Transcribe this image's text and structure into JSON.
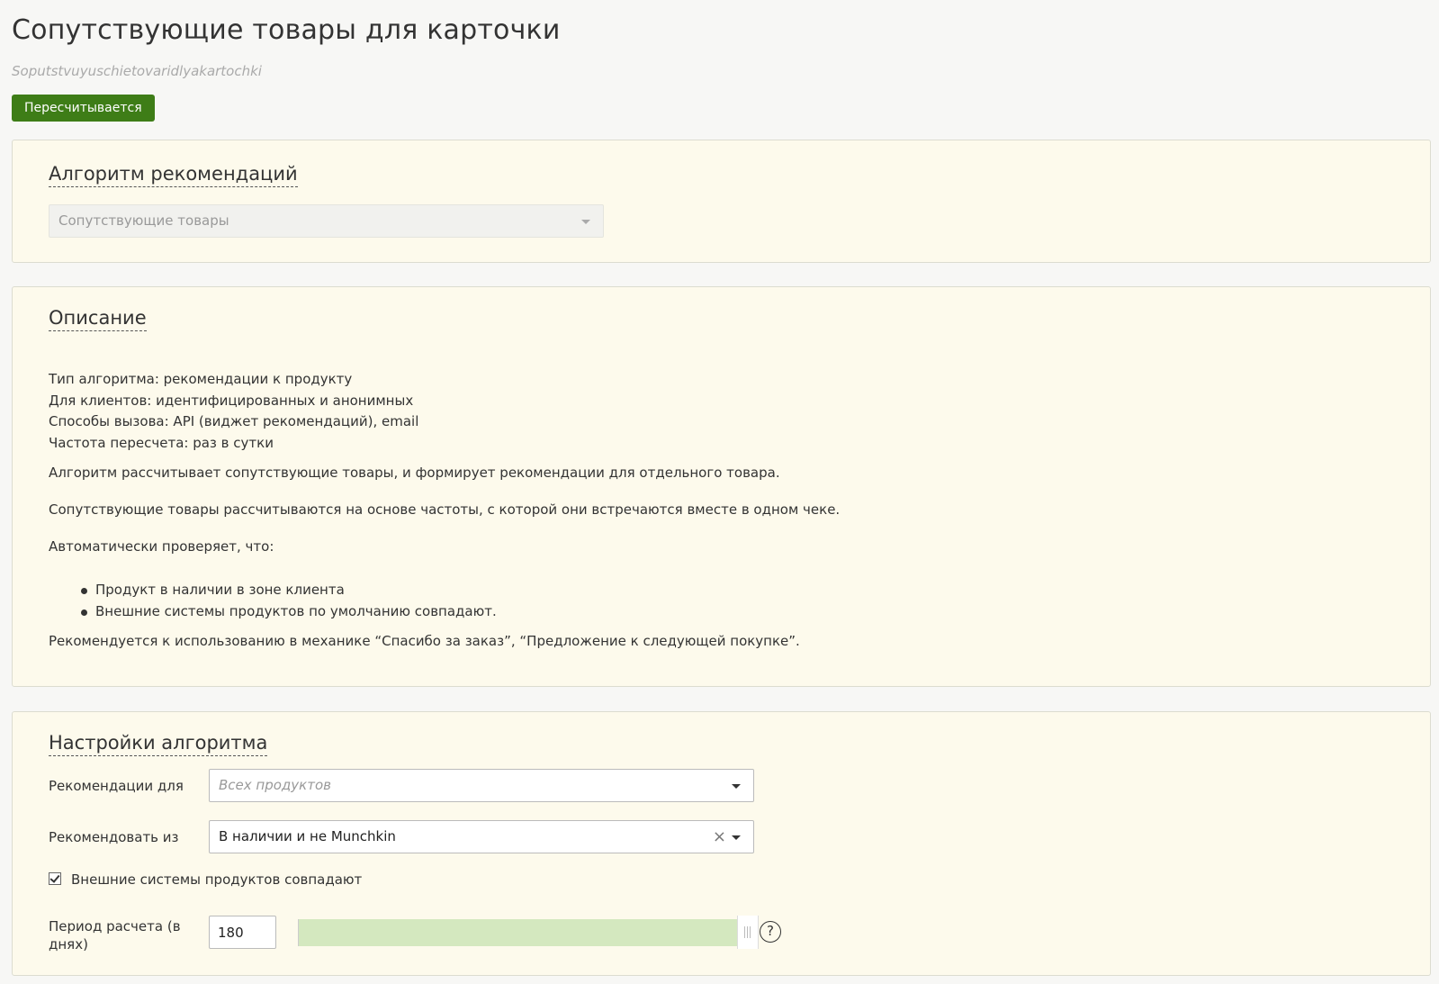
{
  "header": {
    "title": "Сопутствующие товары для карточки",
    "system_name": "Soputstvuyuschietovaridlyakartochki",
    "status": "Пересчитывается",
    "status_color": "#3e7d17"
  },
  "algorithm_panel": {
    "heading": "Алгоритм рекомендаций",
    "selected": "Сопутствующие товары",
    "icon": "chevron-down-icon"
  },
  "description_panel": {
    "heading": "Описание",
    "lines": [
      "Тип алгоритма: рекомендации к продукту",
      "Для клиентов: идентифицированных и анонимных",
      "Способы вызова: API (виджет рекомендаций), email",
      "Частота пересчета: раз в сутки"
    ],
    "para1": "Алгоритм рассчитывает сопутствующие товары, и формирует рекомендации для отдельного товара.",
    "para2": "Сопутствующие товары рассчитываются на основе частоты, с которой они встречаются вместе в одном чеке.",
    "para3": "Автоматически проверяет, что:",
    "checks": [
      "Продукт в наличии в зоне клиента",
      "Внешние системы продуктов по умолчанию совпадают."
    ],
    "para4": "Рекомендуется к использованию в механике “Спасибо за заказ”, “Предложение к следующей покупке”."
  },
  "settings_panel": {
    "heading": "Настройки алгоритма",
    "recommend_for": {
      "label": "Рекомендации для",
      "placeholder": "Всех продуктов"
    },
    "recommend_from": {
      "label": "Рекомендовать из",
      "value": "В наличии и не Munchkin",
      "clear_icon": "×"
    },
    "match_external": {
      "label": "Внешние системы продуктов совпадают",
      "checked": true
    },
    "period": {
      "label": "Период расчета (в днях)",
      "value": "180",
      "slider_fraction": 1.0,
      "help_icon": "?"
    }
  }
}
